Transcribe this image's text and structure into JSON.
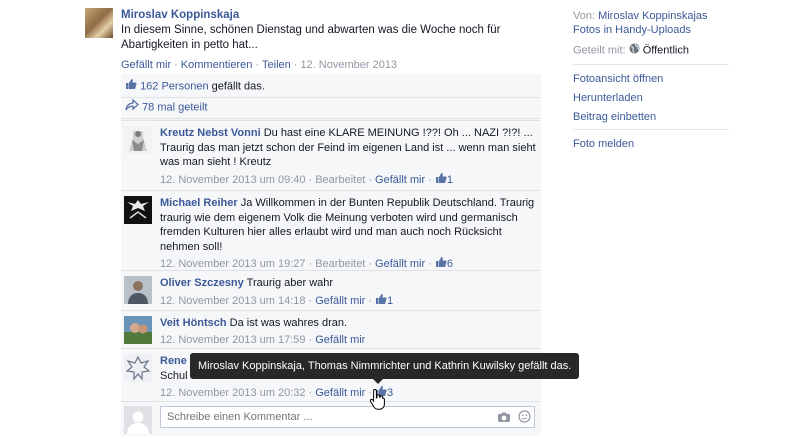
{
  "post": {
    "author": "Miroslav Koppinskaja",
    "text": "In diesem Sinne, schönen Dienstag und abwarten was die Woche noch für Abartigkeiten in petto hat...",
    "actions": {
      "like": "Gefällt mir",
      "comment": "Kommentieren",
      "share": "Teilen",
      "sep": "·",
      "date": "12. November 2013"
    }
  },
  "feedback": {
    "likes_link": "162 Personen",
    "likes_suffix": " gefällt das.",
    "shares": "78 mal geteilt"
  },
  "comments": [
    {
      "name": "Kreutz Nebst Vonni",
      "text": " Du hast eine KLARE MEINUNG !??! Oh ... NAZI ?!?! ... Traurig das man jetzt schon der Feind im eigenen Land ist ... wenn man sieht was man sieht ! Kreutz",
      "date": "12. November 2013 um 09:40",
      "edited": "Bearbeitet",
      "like": "Gefällt mir",
      "like_count": "1"
    },
    {
      "name": "Michael Reiher",
      "text": " Ja Willkommen in der Bunten Republik Deutschland. Traurig traurig wie dem eigenem Volk die Meinung verboten wird und germanisch fremden Kulturen hier alles erlaubt wird und man auch noch Rücksicht nehmen soll!",
      "date": "12. November 2013 um 19:27",
      "edited": "Bearbeitet",
      "like": "Gefällt mir",
      "like_count": "6"
    },
    {
      "name": "Oliver Szczesny",
      "text": " Traurig aber wahr",
      "date": "12. November 2013 um 14:18",
      "like": "Gefällt mir",
      "like_count": "1"
    },
    {
      "name": "Veit Höntsch",
      "text": " Da ist was wahres dran.",
      "date": "12. November 2013 um 17:59",
      "like": "Gefällt mir"
    },
    {
      "name": "Rene",
      "text": "Schul",
      "date": "12. November 2013 um 20:32",
      "like": "Gefällt mir",
      "like_count": "3"
    }
  ],
  "compose": {
    "placeholder": "Schreibe einen Kommentar ..."
  },
  "tooltip": "Miroslav Koppinskaja, Thomas Nimmrichter und Kathrin Kuwilsky gefällt das.",
  "sidebar": {
    "from_label": "Von: ",
    "from_name": "Miroslav Koppinskajas",
    "album": "Fotos in Handy-Uploads",
    "shared_label": "Geteilt mit: ",
    "shared_value": "Öffentlich",
    "actions": [
      "Fotoansicht öffnen",
      "Herunterladen",
      "Beitrag einbetten"
    ],
    "report": "Foto melden"
  },
  "colors": {
    "link": "#3b5998",
    "muted": "#9197a3",
    "panel": "#f6f7f9",
    "tooltip": "#282828"
  },
  "icons": [
    "like-thumb-icon",
    "share-arrow-icon",
    "camera-icon",
    "smiley-icon",
    "globe-icon",
    "hand-cursor-icon"
  ]
}
